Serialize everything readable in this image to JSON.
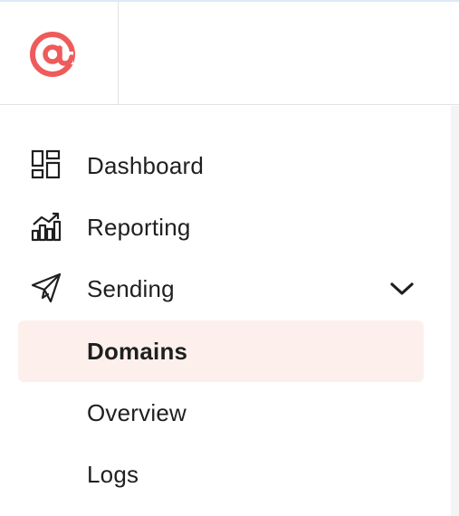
{
  "brand": {
    "logo_icon": "at-sign-logo",
    "accent_color": "#ef5b5b"
  },
  "nav": {
    "items": [
      {
        "label": "Dashboard",
        "icon": "dashboard-icon"
      },
      {
        "label": "Reporting",
        "icon": "reporting-chart-icon"
      },
      {
        "label": "Sending",
        "icon": "paper-plane-icon",
        "expanded": true
      }
    ],
    "sending_submenu": [
      {
        "label": "Domains",
        "active": true
      },
      {
        "label": "Overview",
        "active": false
      },
      {
        "label": "Logs",
        "active": false
      }
    ]
  },
  "colors": {
    "active_bg": "#fdf0ec",
    "text": "#1f1f1f"
  }
}
